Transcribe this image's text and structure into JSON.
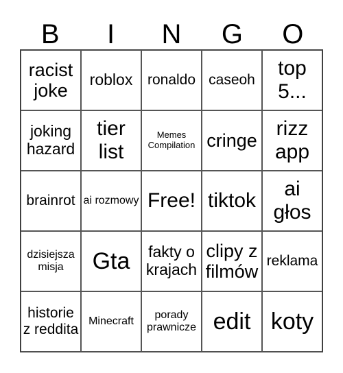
{
  "title_letters": [
    "B",
    "I",
    "N",
    "G",
    "O"
  ],
  "cells": [
    {
      "text": "racist joke"
    },
    {
      "text": "roblox"
    },
    {
      "text": "ronaldo"
    },
    {
      "text": "caseoh"
    },
    {
      "text": "top 5..."
    },
    {
      "text": "joking hazard"
    },
    {
      "text": "tier list"
    },
    {
      "text": "Memes Compilation"
    },
    {
      "text": "cringe"
    },
    {
      "text": "rizz app"
    },
    {
      "text": "brainrot"
    },
    {
      "text": "ai rozmowy"
    },
    {
      "text": "Free!"
    },
    {
      "text": "tiktok"
    },
    {
      "text": "ai głos"
    },
    {
      "text": "dzisiejsza misja"
    },
    {
      "text": "Gta"
    },
    {
      "text": "fakty o krajach"
    },
    {
      "text": "clipy z filmów"
    },
    {
      "text": "reklama"
    },
    {
      "text": "historie z reddita"
    },
    {
      "text": "Minecraft"
    },
    {
      "text": "porady prawnicze"
    },
    {
      "text": "edit"
    },
    {
      "text": "koty"
    }
  ]
}
